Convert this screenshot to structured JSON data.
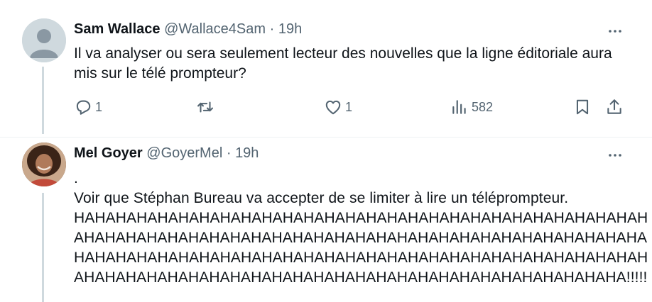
{
  "tweets": [
    {
      "name": "Sam Wallace",
      "handle": "@Wallace4Sam",
      "separator": "·",
      "time": "19h",
      "text": "Il va analyser ou sera seulement lecteur des nouvelles que la ligne éditoriale aura mis sur le télé prompteur?",
      "replies": "1",
      "retweets": "",
      "likes": "1",
      "views": "582"
    },
    {
      "name": "Mel Goyer",
      "handle": "@GoyerMel",
      "separator": "·",
      "time": "19h",
      "lines": [
        ".",
        "Voir que Stéphan Bureau va accepter de se limiter à lire un téléprompteur.",
        "HAHAHAHAHAHAHAHAHAHAHAHAHAHAHAHAHAHAHAHAHAHAHAHAHAHAHAH",
        "AHAHAHAHAHAHAHAHAHAHAHAHAHAHAHAHAHAHAHAHAHAHAHAHAHAHAHA",
        "HAHAHAHAHAHAHAHAHAHAHAHAHAHAHAHAHAHAHAHAHAHAHAHAHAHAHAH",
        "AHAHAHAHAHAHAHAHAHAHAHAHAHAHAHAHAHAHAHAHAHAHAHAHAHAHA!!!!!"
      ]
    }
  ],
  "icons": {
    "reply": "reply-icon",
    "retweet": "retweet-icon",
    "like": "heart-icon",
    "views": "views-icon",
    "bookmark": "bookmark-icon",
    "share": "share-icon",
    "more": "more-icon"
  },
  "colors": {
    "text": "#0f1419",
    "secondary": "#536471",
    "thread_line": "#cfd9de"
  }
}
